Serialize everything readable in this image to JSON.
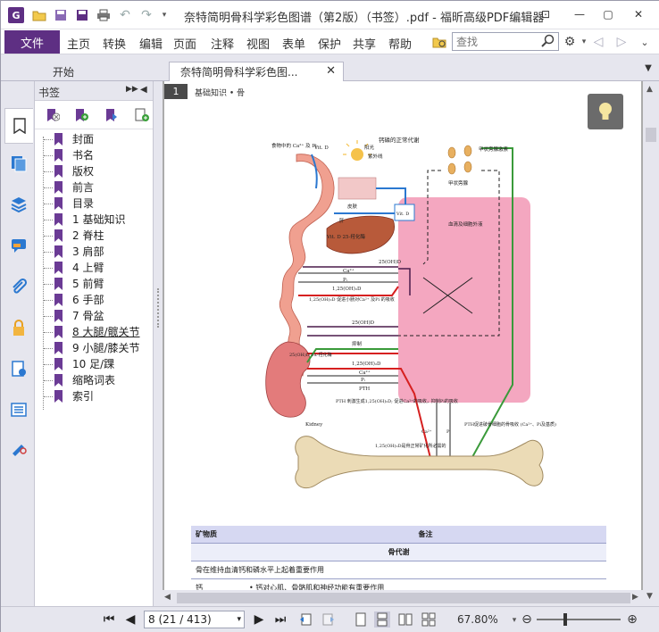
{
  "window": {
    "title": "奈特简明骨科学彩色图谱（第2版）（书签）.pdf - 福昕高级PDF编辑器"
  },
  "menu": {
    "file": "文件",
    "items": [
      "主页",
      "转换",
      "编辑",
      "页面",
      "注释",
      "视图",
      "表单",
      "保护",
      "共享",
      "帮助"
    ],
    "search_placeholder": "查找"
  },
  "tabs": {
    "start": "开始",
    "doc": "奈特简明骨科学彩色图..."
  },
  "bookmarks": {
    "header": "书签",
    "items": [
      {
        "label": "封面"
      },
      {
        "label": "书名"
      },
      {
        "label": "版权"
      },
      {
        "label": "前言"
      },
      {
        "label": "目录"
      },
      {
        "label": "1 基础知识"
      },
      {
        "label": "2 脊柱"
      },
      {
        "label": "3 肩部"
      },
      {
        "label": "4 上臂"
      },
      {
        "label": "5 前臂"
      },
      {
        "label": "6 手部"
      },
      {
        "label": "7 骨盆"
      },
      {
        "label": "8 大腿/髋关节",
        "active": true
      },
      {
        "label": "9 小腿/膝关节"
      },
      {
        "label": "10 足/踝"
      },
      {
        "label": "缩略词表"
      },
      {
        "label": "索引"
      }
    ]
  },
  "page": {
    "chapter_num": "1",
    "header": "基础知识 • 骨",
    "diagram_title": "钙磷的正常代谢",
    "labels": {
      "food": "食物中的 Ca²⁺ 及 Pi",
      "vitd": "Vit. D",
      "sun": "阳光",
      "uv": "紫外线",
      "skin": "皮肤",
      "liver": "肝",
      "vitd25": "Vit. D 25-羟化酶",
      "parathyroid": "甲状旁腺激素",
      "parathyroid2": "甲状旁腺",
      "ecf": "血清及细胞外液",
      "oh25": "25(OH)D",
      "ca": "Ca²⁺",
      "pi": "Pᵢ",
      "oh125": "1,25(OH)₂D",
      "absorb": "1,25(OH)₂D 促进小肠对Ca²⁺ 及Pi 的吸收",
      "inhibit": "抑制",
      "hydroxylase": "25(OH)D 1α-羟化酶",
      "pth": "PTH",
      "pth_effect": "PTH 刺激生成1,25(OH)₂D; 促进Ca²⁺的吸收，抑制Pi的吸收",
      "kidney": "Kidney",
      "bone_note": "1,25(OH)₂D是骨正常矿化所必需的",
      "pth_bone": "PTH促进破骨细胞的骨吸收 (Ca²⁺、Pi及基质)"
    },
    "table": {
      "col1": "矿物质",
      "col2": "备注",
      "section": "骨代谢",
      "row1": "骨在维持血清钙和磷水平上起着重要作用",
      "row2_name": "钙",
      "row2_note": "• 钙对心肌、骨骼肌和神经功能有重要作用"
    }
  },
  "status": {
    "page_display": "8 (21 / 413)",
    "zoom": "67.80%"
  },
  "colors": {
    "brand": "#5e2f83",
    "pink": "#f4a7c0",
    "red": "#d62020",
    "blue": "#2b78d0",
    "green": "#3a9a3a",
    "bone": "#e8d8b0"
  }
}
